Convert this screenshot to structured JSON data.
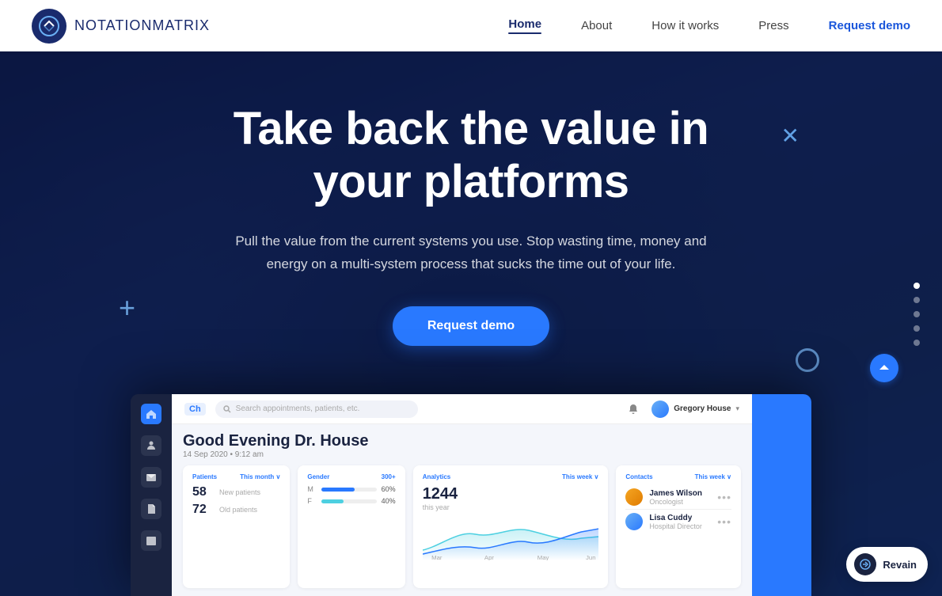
{
  "nav": {
    "logo_text_bold": "NOTATION",
    "logo_text_light": "MATRIX",
    "links": [
      {
        "id": "home",
        "label": "Home",
        "active": true
      },
      {
        "id": "about",
        "label": "About",
        "active": false
      },
      {
        "id": "how-it-works",
        "label": "How it works",
        "active": false
      },
      {
        "id": "press",
        "label": "Press",
        "active": false
      }
    ],
    "cta_label": "Request demo"
  },
  "hero": {
    "title_line1": "Take back the value in",
    "title_line2": "your platforms",
    "subtitle": "Pull the value from the current systems you use. Stop wasting time, money and energy on a multi-system process that sucks the time out of your life.",
    "cta_label": "Request demo"
  },
  "side_dots": [
    {
      "id": 1,
      "active": true
    },
    {
      "id": 2,
      "active": false
    },
    {
      "id": 3,
      "active": false
    },
    {
      "id": 4,
      "active": false
    },
    {
      "id": 5,
      "active": false
    }
  ],
  "dashboard": {
    "ch_badge": "Ch",
    "search_placeholder": "Search appointments, patients, etc.",
    "username": "Gregory House",
    "greeting": "Good Evening Dr. House",
    "date": "14 Sep 2020  •  9:12 am",
    "patients_title": "Patients",
    "patients_period": "This month  ∨",
    "new_patients_count": "58",
    "new_patients_label": "New patients",
    "old_patients_count": "72",
    "old_patients_label": "Old patients",
    "gender_title": "Gender",
    "gender_count": "300+",
    "gender_male_label": "M",
    "gender_male_pct": 60,
    "gender_female_label": "F",
    "gender_female_pct": 40,
    "analytics_title": "Analytics",
    "analytics_period": "This week  ∨",
    "analytics_num": "1244",
    "analytics_sub": "this year",
    "contacts_title": "Contacts",
    "contacts_period": "This week  ∨",
    "contacts": [
      {
        "name": "James Wilson",
        "role": "Oncologist",
        "color": "orange"
      },
      {
        "name": "Lisa Cuddy",
        "role": "Hospital Director",
        "color": "blue"
      }
    ]
  },
  "revain": {
    "label": "Revain"
  },
  "decorative": {
    "cross": "✕",
    "plus": "+",
    "scroll_label": "↑"
  }
}
